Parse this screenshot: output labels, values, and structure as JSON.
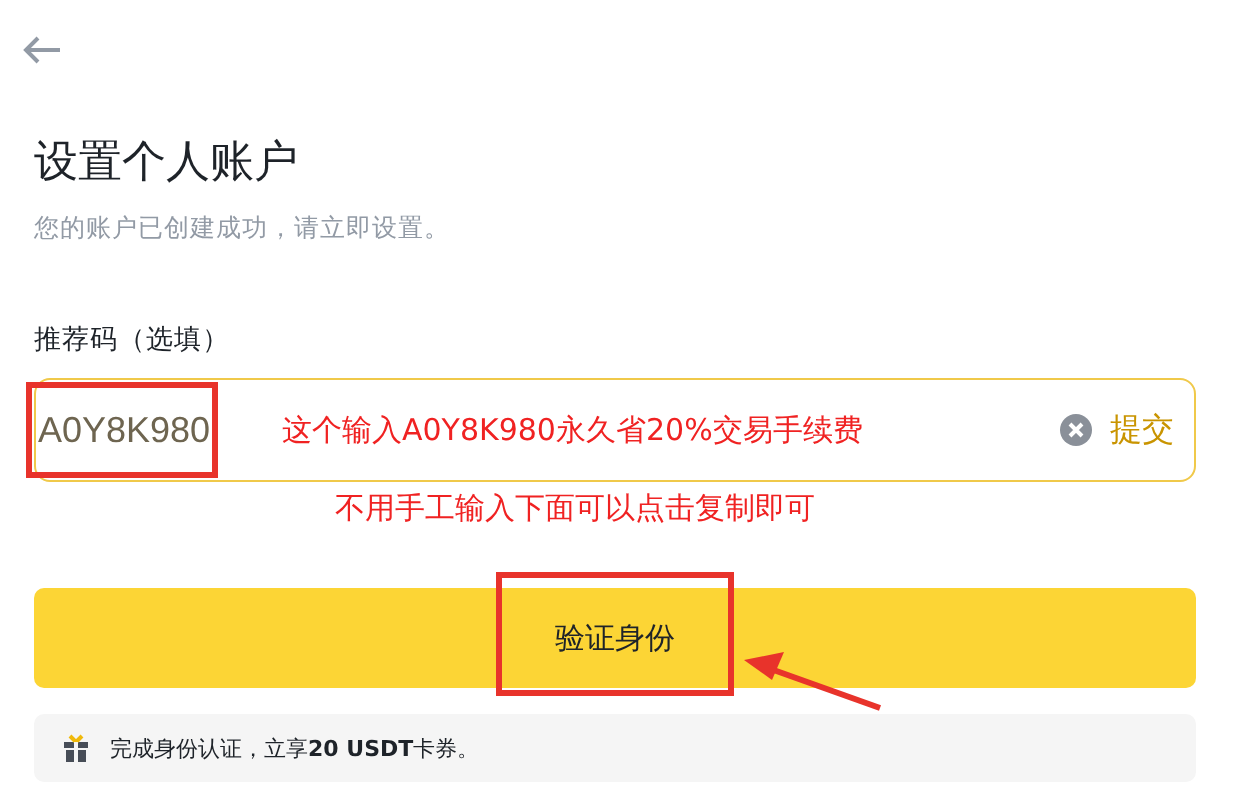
{
  "title": "设置个人账户",
  "subtitle": "您的账户已创建成功，请立即设置。",
  "referral": {
    "label": "推荐码（选填）",
    "value": "A0Y8K980",
    "submit": "提交"
  },
  "annotations": {
    "field_note": "这个输入A0Y8K980永久省20%交易手续费",
    "copy_note": "不用手工输入下面可以点击复制即可"
  },
  "verify_button": "验证身份",
  "promo": "完成身份认证，立享**20 USDT**卡券。"
}
